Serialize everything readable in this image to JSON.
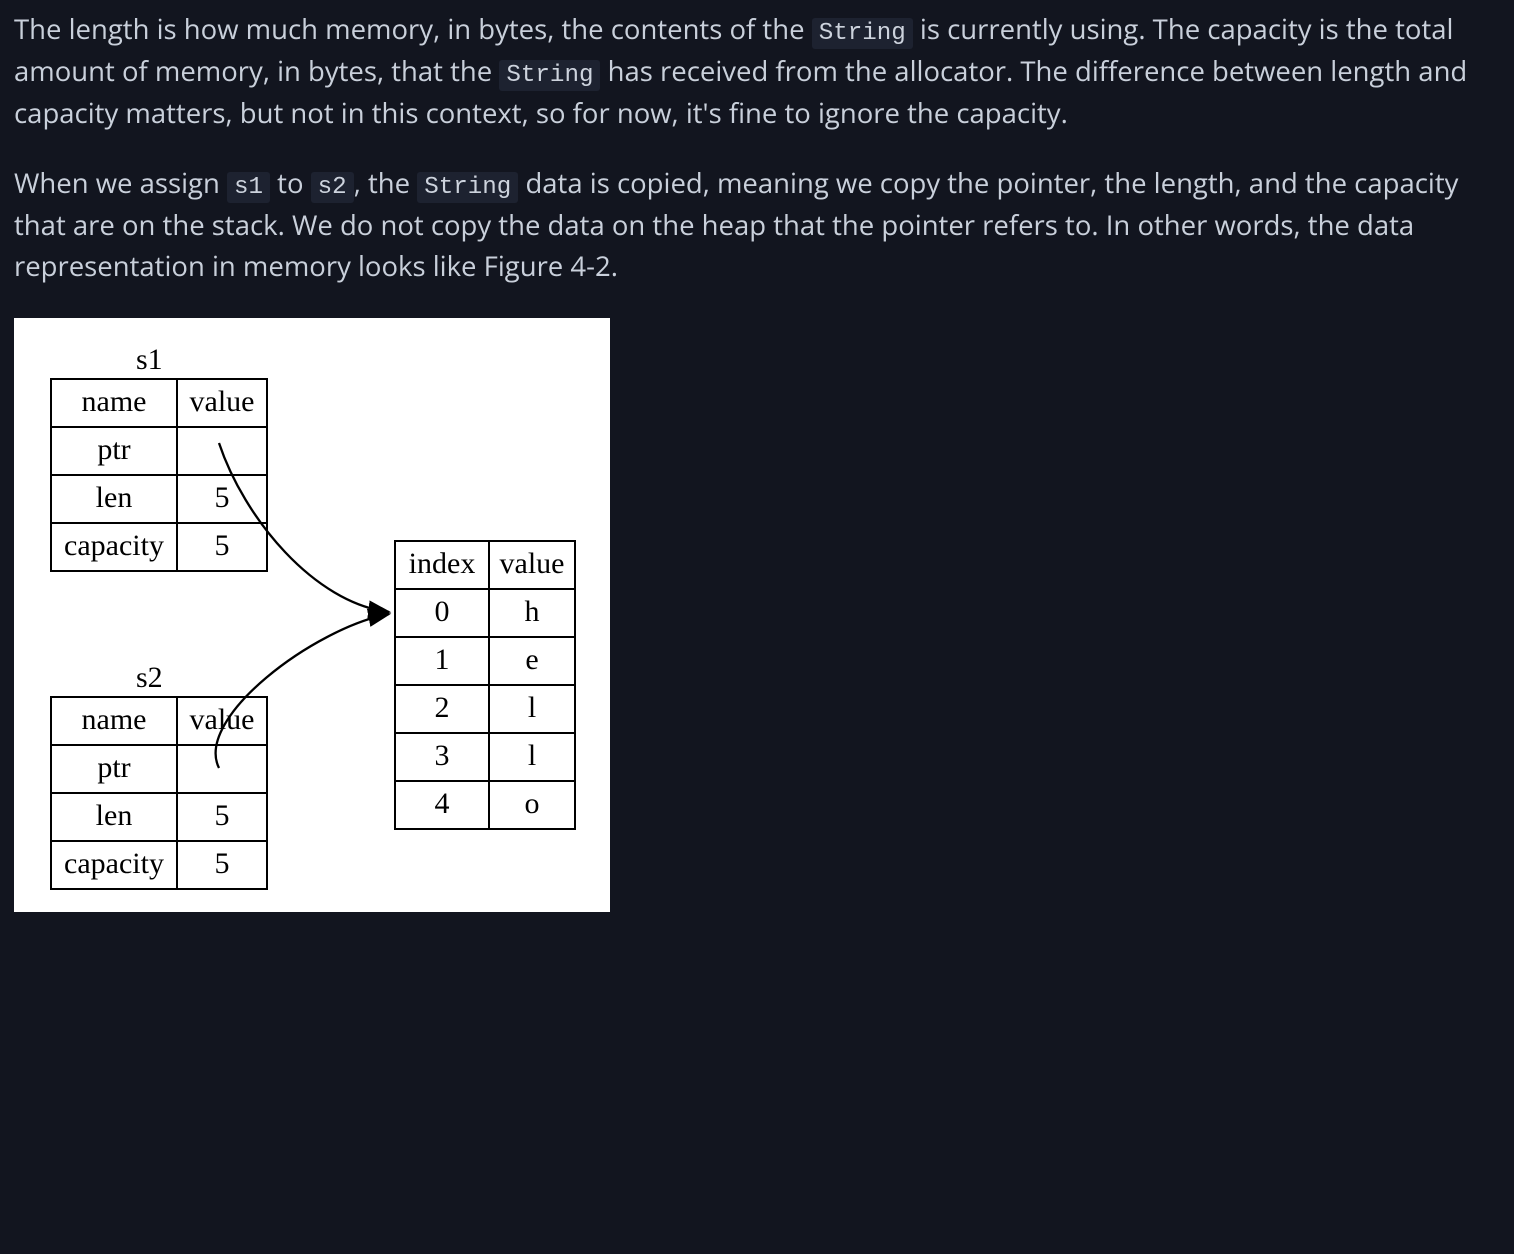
{
  "paragraph1": {
    "t1": "The length is how much memory, in bytes, the contents of the ",
    "c1": "String",
    "t2": " is currently using. The capacity is the total amount of memory, in bytes, that the ",
    "c2": "String",
    "t3": " has received from the allocator. The difference between length and capacity matters, but not in this context, so for now, it's fine to ignore the capacity."
  },
  "paragraph2": {
    "t1": "When we assign ",
    "c1": "s1",
    "t2": " to ",
    "c2": "s2",
    "t3": ", the ",
    "c3": "String",
    "t4": " data is copied, meaning we copy the pointer, the length, and the capacity that are on the stack. We do not copy the data on the heap that the pointer refers to. In other words, the data representation in memory looks like Figure 4-2."
  },
  "figure": {
    "s1_label": "s1",
    "s2_label": "s2",
    "stack_header_name": "name",
    "stack_header_value": "value",
    "row_ptr": "ptr",
    "row_len": "len",
    "row_cap": "capacity",
    "len_value": "5",
    "cap_value": "5",
    "heap_header_index": "index",
    "heap_header_value": "value",
    "heap_rows": [
      {
        "idx": "0",
        "val": "h"
      },
      {
        "idx": "1",
        "val": "e"
      },
      {
        "idx": "2",
        "val": "l"
      },
      {
        "idx": "3",
        "val": "l"
      },
      {
        "idx": "4",
        "val": "o"
      }
    ]
  }
}
